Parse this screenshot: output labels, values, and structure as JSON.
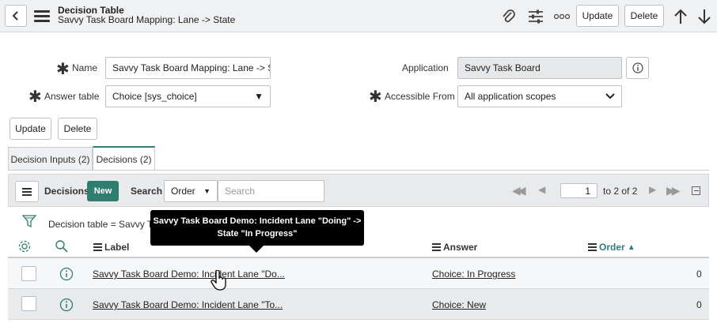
{
  "header": {
    "title": "Decision Table",
    "subtitle": "Savvy Task Board Mapping: Lane -> State",
    "update_label": "Update",
    "delete_label": "Delete"
  },
  "form": {
    "name_label": "Name",
    "name_value": "Savvy Task Board Mapping: Lane -> Stat",
    "answer_table_label": "Answer table",
    "answer_table_value": "Choice [sys_choice]",
    "application_label": "Application",
    "application_value": "Savvy Task Board",
    "accessible_label": "Accessible From",
    "accessible_value": "All application scopes",
    "update_label": "Update",
    "delete_label": "Delete"
  },
  "tabs": [
    {
      "label": "Decision Inputs (2)"
    },
    {
      "label": "Decisions (2)"
    }
  ],
  "list": {
    "title": "Decisions",
    "new_label": "New",
    "search_label": "Search",
    "search_field": "Order",
    "search_placeholder": "Search",
    "page_value": "1",
    "page_range": "to 2 of 2",
    "filter_text": "Decision table = Savvy Task",
    "columns": {
      "label": "Label",
      "answer": "Answer",
      "order": "Order"
    },
    "rows": [
      {
        "label": "Savvy Task Board Demo: Incident Lane \"Do...",
        "answer": "Choice: In Progress",
        "order": "0"
      },
      {
        "label": "Savvy Task Board Demo: Incident Lane \"To...",
        "answer": "Choice: New",
        "order": "0"
      }
    ]
  },
  "tooltip": {
    "line1": "Savvy Task Board Demo: Incident Lane \"Doing\" ->",
    "line2": "State \"In Progress\""
  },
  "colors": {
    "accent": "#2e7d6f",
    "sort_accent": "#2e7d7a"
  }
}
